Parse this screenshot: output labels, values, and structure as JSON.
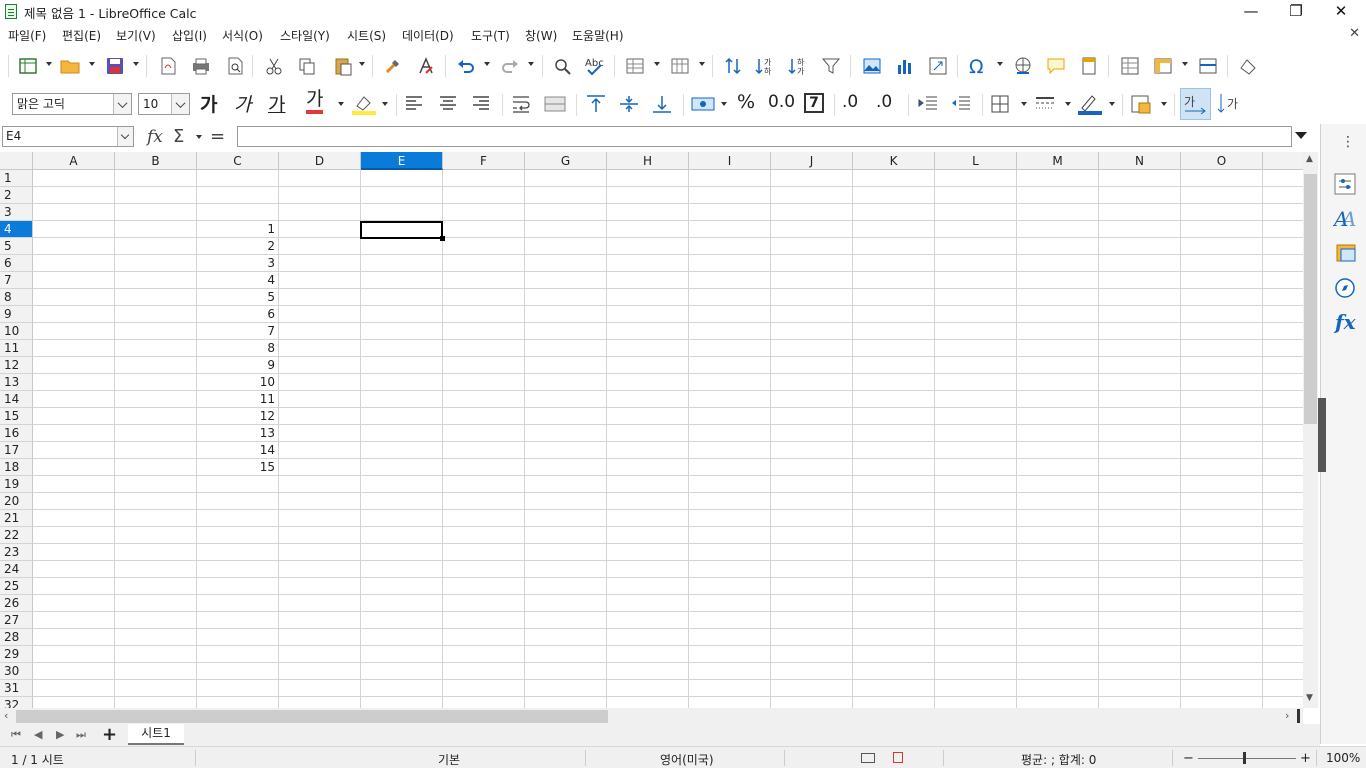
{
  "window": {
    "title": "제목 없음 1 - LibreOffice Calc",
    "minimize": "—",
    "restore": "❐",
    "close": "✕",
    "doc_close": "✕"
  },
  "menu": [
    "파일(F)",
    "편집(E)",
    "보기(V)",
    "삽입(I)",
    "서식(O)",
    "스타일(Y)",
    "시트(S)",
    "데이터(D)",
    "도구(T)",
    "창(W)",
    "도움말(H)"
  ],
  "formatting": {
    "font_name": "맑은 고딕",
    "font_size": "10",
    "bold_glyph": "가",
    "italic_glyph": "가",
    "underline_glyph": "가",
    "font_color_glyph": "가",
    "percent_glyph": "%",
    "number_glyph": "0.0",
    "date_glyph": "7",
    "add_decimal_glyph": ".0",
    "remove_decimal_glyph": ".0",
    "wrap_glyph": "가",
    "font_color": "#e53935",
    "highlight_color": "#ffeb3b",
    "border_color": "#1565c0"
  },
  "formula_bar": {
    "name_box": "E4",
    "fx": "fx",
    "sum": "Σ",
    "equals": "=",
    "formula": ""
  },
  "columns": [
    "A",
    "B",
    "C",
    "D",
    "E",
    "F",
    "G",
    "H",
    "I",
    "J",
    "K",
    "L",
    "M",
    "N",
    "O"
  ],
  "selected_column": "E",
  "rows": [
    "1",
    "2",
    "3",
    "4",
    "5",
    "6",
    "7",
    "8",
    "9",
    "10",
    "11",
    "12",
    "13",
    "14",
    "15",
    "16",
    "17",
    "18",
    "19",
    "20",
    "21",
    "22",
    "23",
    "24",
    "25",
    "26",
    "27",
    "28",
    "29",
    "30",
    "31",
    "32"
  ],
  "selected_row": "4",
  "active_cell": "E4",
  "column_c_values": [
    "1",
    "2",
    "3",
    "4",
    "5",
    "6",
    "7",
    "8",
    "9",
    "10",
    "11",
    "12",
    "13",
    "14",
    "15"
  ],
  "sheet_tab": "시트1",
  "add_sheet": "+",
  "status": {
    "sheet_pos": "1 / 1 시트",
    "page_style": "기본",
    "language": "영어(미국)",
    "summary": "평균: ; 합계: 0",
    "zoom_minus": "−",
    "zoom_plus": "+",
    "zoom": "100%"
  },
  "colors": {
    "accent": "#0a7bd8",
    "sheet_icon": "#1e7e34"
  }
}
